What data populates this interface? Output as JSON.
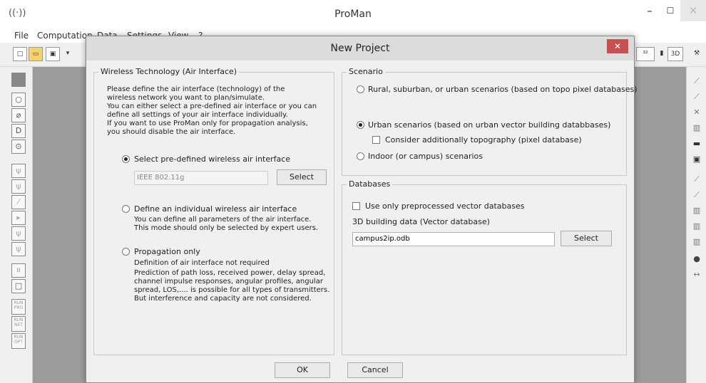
{
  "app": {
    "title": "ProMan"
  },
  "menu": [
    "File",
    "Computation",
    "Data",
    "Settings",
    "View",
    "?"
  ],
  "toolbar": {
    "btn_3d_label": "3D"
  },
  "left_toolbar": {
    "run_buttons": [
      "RUN\nPRO",
      "RUN\nNET",
      "RUN\nOPT"
    ]
  },
  "dialog": {
    "title": "New Project",
    "wireless": {
      "title": "Wireless Technology (Air Interface)",
      "intro": [
        "Please define the air interface (technology) of the",
        "wireless network you want to plan/simulate.",
        "You can either select a pre-defined air interface or you can",
        "define all settings of your air interface individually.",
        "If you want to use ProMan only for propagation analysis,",
        "you should disable the air interface."
      ],
      "predefined_label": "Select pre-defined wireless air interface",
      "predefined_value": "IEEE 802.11g",
      "select_label": "Select",
      "individual_label": "Define an individual wireless air interface",
      "individual_desc": [
        "You can define all parameters of the air interface.",
        "This mode should only be selected by expert users."
      ],
      "propagation_label": "Propagation only",
      "propagation_desc": [
        "Definition of air interface not required",
        "Prediction of path loss, received power, delay spread,",
        "channel impulse responses, angular profiles, angular",
        "spread, LOS,.... is possible for all types of transmitters.",
        "But interference and capacity are not considered."
      ]
    },
    "scenario": {
      "title": "Scenario",
      "rural_label": "Rural, suburban, or urban scenarios (based on topo pixel databases)",
      "urban_label": "Urban scenarios (based on urban vector building databbases)",
      "topo_label": "Consider additionally topography (pixel database)",
      "indoor_label": "Indoor (or campus) scenarios"
    },
    "databases": {
      "title": "Databases",
      "preprocessed_label": "Use only preprocessed vector databases",
      "building_label": "3D building data (Vector database)",
      "building_value": "campus2ip.odb",
      "select_label": "Select"
    },
    "ok_label": "OK",
    "cancel_label": "Cancel"
  }
}
